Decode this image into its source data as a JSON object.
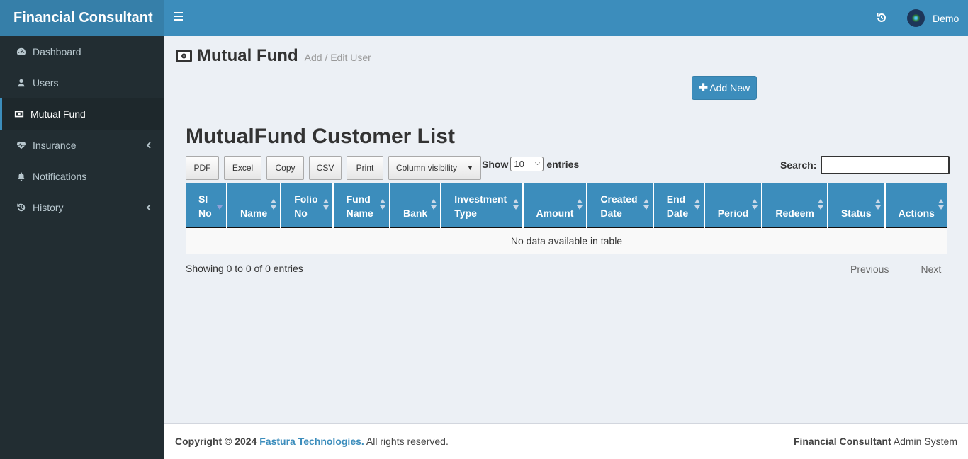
{
  "brand": {
    "title": "Financial Consultant"
  },
  "sidebar": {
    "items": [
      {
        "label": "Dashboard",
        "icon": "dashboard-icon"
      },
      {
        "label": "Users",
        "icon": "user-icon"
      },
      {
        "label": "Mutual Fund",
        "icon": "money-icon",
        "active": true
      },
      {
        "label": "Insurance",
        "icon": "heartbeat-icon",
        "has_children": true
      },
      {
        "label": "Notifications",
        "icon": "bell-icon"
      },
      {
        "label": "History",
        "icon": "history-icon",
        "has_children": true
      }
    ]
  },
  "header": {
    "user_name": "Demo"
  },
  "page": {
    "title": "Mutual Fund",
    "subtitle": "Add / Edit User"
  },
  "actions": {
    "add_new": "Add New"
  },
  "list": {
    "title": "MutualFund Customer List",
    "export_buttons": [
      "PDF",
      "Excel",
      "Copy",
      "CSV",
      "Print"
    ],
    "column_visibility": "Column visibility",
    "show_label": "Show",
    "page_length": "10",
    "entries_label": "entries",
    "search_label": "Search:",
    "search_value": "",
    "columns": [
      [
        "Sl",
        "No"
      ],
      [
        "",
        "Name"
      ],
      [
        "Folio",
        "No"
      ],
      [
        "Fund",
        "Name"
      ],
      [
        "",
        "Bank"
      ],
      [
        "Investment",
        "Type"
      ],
      [
        "",
        "Amount"
      ],
      [
        "Created",
        "Date"
      ],
      [
        "End",
        "Date"
      ],
      [
        "",
        "Period"
      ],
      [
        "",
        "Redeem"
      ],
      [
        "",
        "Status"
      ],
      [
        "",
        "Actions"
      ]
    ],
    "empty_message": "No data available in table",
    "info": "Showing 0 to 0 of 0 entries",
    "pagination": {
      "previous": "Previous",
      "next": "Next"
    }
  },
  "footer": {
    "copyright_prefix": "Copyright © 2024",
    "company": "Fastura Technologies.",
    "rights": "All rights reserved.",
    "system_name": "Financial Consultant",
    "system_suffix": "Admin System"
  },
  "colors": {
    "primary": "#3c8dbc",
    "sidebar": "#222d32",
    "brand_bg": "#367fa9",
    "content_bg": "#ecf0f5"
  }
}
